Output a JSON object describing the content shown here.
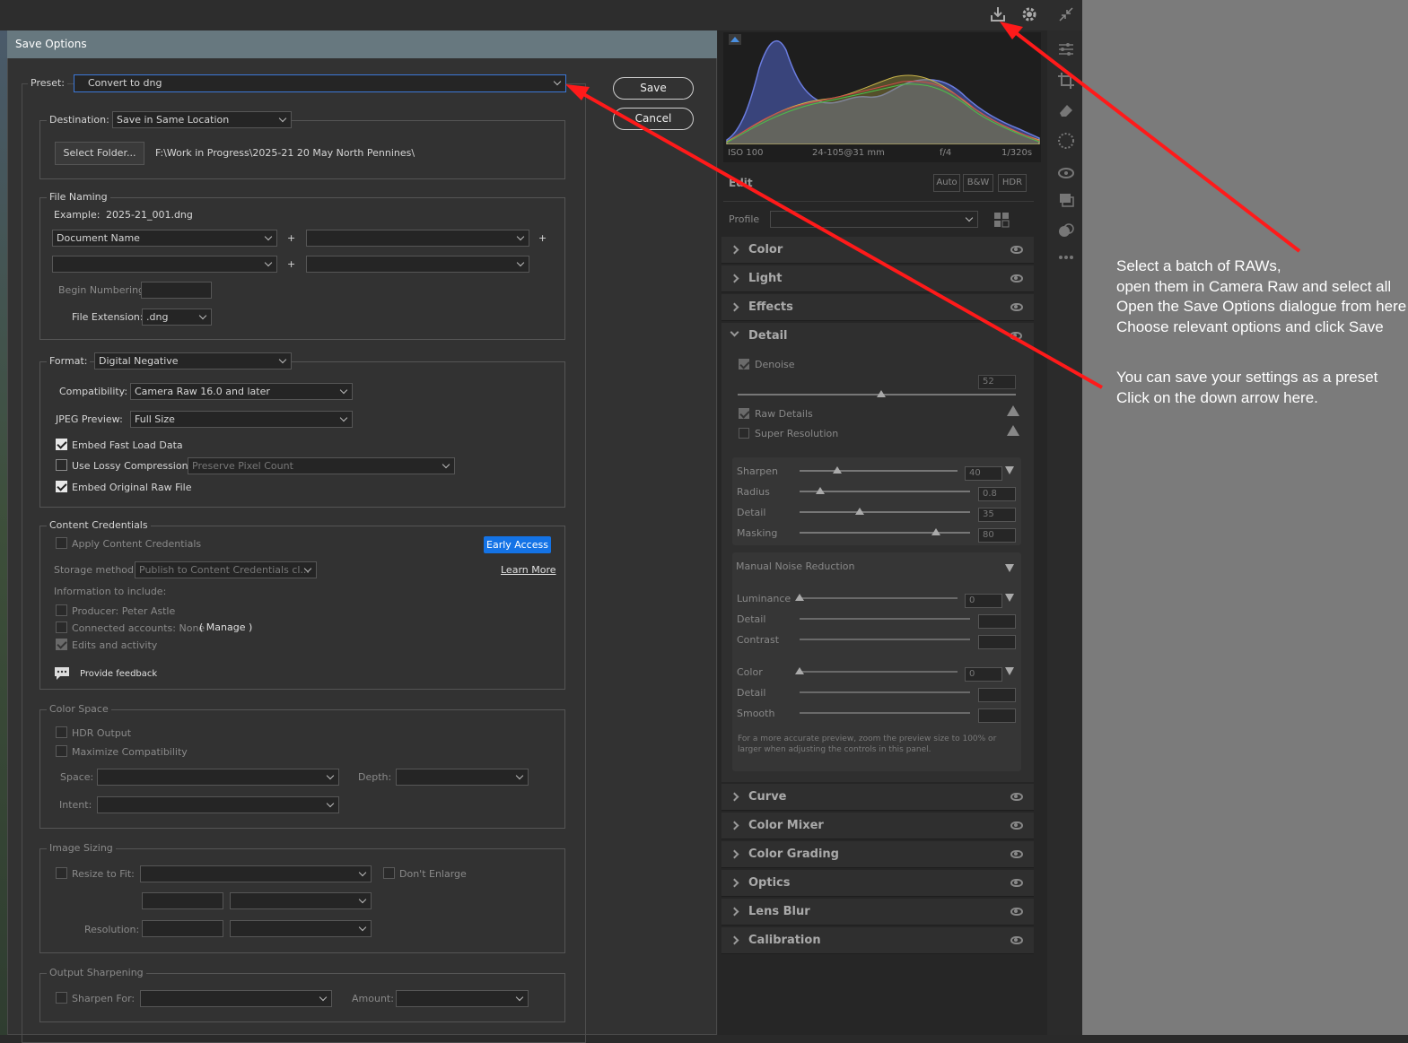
{
  "dialog": {
    "title": "Save Options",
    "preset_label": "Preset:",
    "preset_value": "Convert to dng",
    "save_label": "Save",
    "cancel_label": "Cancel",
    "destination": {
      "label": "Destination:",
      "value": "Save in Same Location",
      "select_folder_label": "Select Folder...",
      "path": "F:\\Work in Progress\\2025-21 20 May North Pennines\\"
    },
    "file_naming": {
      "legend": "File Naming",
      "example_label": "Example:",
      "example_value": "2025-21_001.dng",
      "field1": "Document Name",
      "plus": "+",
      "begin_numbering_label": "Begin Numbering:",
      "extension_label": "File Extension:",
      "extension_value": ".dng"
    },
    "format": {
      "label": "Format:",
      "value": "Digital Negative",
      "compat_label": "Compatibility:",
      "compat_value": "Camera Raw 16.0 and later",
      "jpeg_label": "JPEG Preview:",
      "jpeg_value": "Full Size",
      "embed_fast": "Embed Fast Load Data",
      "lossy": "Use Lossy Compression:",
      "lossy_value": "Preserve Pixel Count",
      "embed_raw": "Embed Original Raw File"
    },
    "content_credentials": {
      "legend": "Content Credentials",
      "apply": "Apply Content Credentials",
      "early_access": "Early Access",
      "storage_label": "Storage method:",
      "storage_value": "Publish to Content Credentials cl...",
      "learn_more": "Learn More",
      "info_label": "Information to include:",
      "producer": "Producer: Peter Astle",
      "connected": "Connected accounts: None",
      "manage": "( Manage  )",
      "edits": "Edits and activity",
      "feedback": "Provide feedback"
    },
    "color_space": {
      "legend": "Color Space",
      "hdr": "HDR Output",
      "maximize": "Maximize Compatibility",
      "space_label": "Space:",
      "depth_label": "Depth:",
      "intent_label": "Intent:"
    },
    "image_sizing": {
      "legend": "Image Sizing",
      "resize": "Resize to Fit:",
      "dont_enlarge": "Don't Enlarge",
      "resolution_label": "Resolution:"
    },
    "output_sharpening": {
      "legend": "Output Sharpening",
      "sharpen_for": "Sharpen For:",
      "amount_label": "Amount:"
    }
  },
  "panel": {
    "histogram_info": {
      "iso": "ISO 100",
      "lens": "24-105@31 mm",
      "aperture": "f/4",
      "shutter": "1/320s"
    },
    "edit_label": "Edit",
    "edit_buttons": [
      "Auto",
      "B&W",
      "HDR"
    ],
    "profile_label": "Profile",
    "sections_top": [
      "Color",
      "Light",
      "Effects"
    ],
    "detail_label": "Detail",
    "denoise_label": "Denoise",
    "denoise_value": "52",
    "raw_details_label": "Raw Details",
    "super_res_label": "Super Resolution",
    "sharpen": [
      {
        "label": "Sharpen",
        "value": "40",
        "level": 0.24
      },
      {
        "label": "Radius",
        "value": "0.8",
        "level": 0.12
      },
      {
        "label": "Detail",
        "value": "35",
        "level": 0.35
      },
      {
        "label": "Masking",
        "value": "80",
        "level": 0.8
      }
    ],
    "noise_title": "Manual Noise Reduction",
    "noise": [
      {
        "label": "Luminance",
        "value": "0"
      },
      {
        "label": "Detail",
        "value": ""
      },
      {
        "label": "Contrast",
        "value": ""
      },
      {
        "label": "Color",
        "value": "0"
      },
      {
        "label": "Detail",
        "value": ""
      },
      {
        "label": "Smooth",
        "value": ""
      }
    ],
    "noise_note": "For a more accurate preview, zoom the preview size to 100% or larger when adjusting the controls in this panel.",
    "sections_bottom": [
      "Curve",
      "Color Mixer",
      "Color Grading",
      "Optics",
      "Lens Blur",
      "Calibration"
    ]
  },
  "annotations": {
    "block1": [
      "Select a batch of RAWs,",
      "open them in Camera Raw and select all",
      "Open the Save Options dialogue from here",
      "Choose relevant options and click Save"
    ],
    "block2": [
      "You can save your settings as a preset",
      "Click on the down arrow here."
    ],
    "arrow_color": "#ff1a1a"
  }
}
